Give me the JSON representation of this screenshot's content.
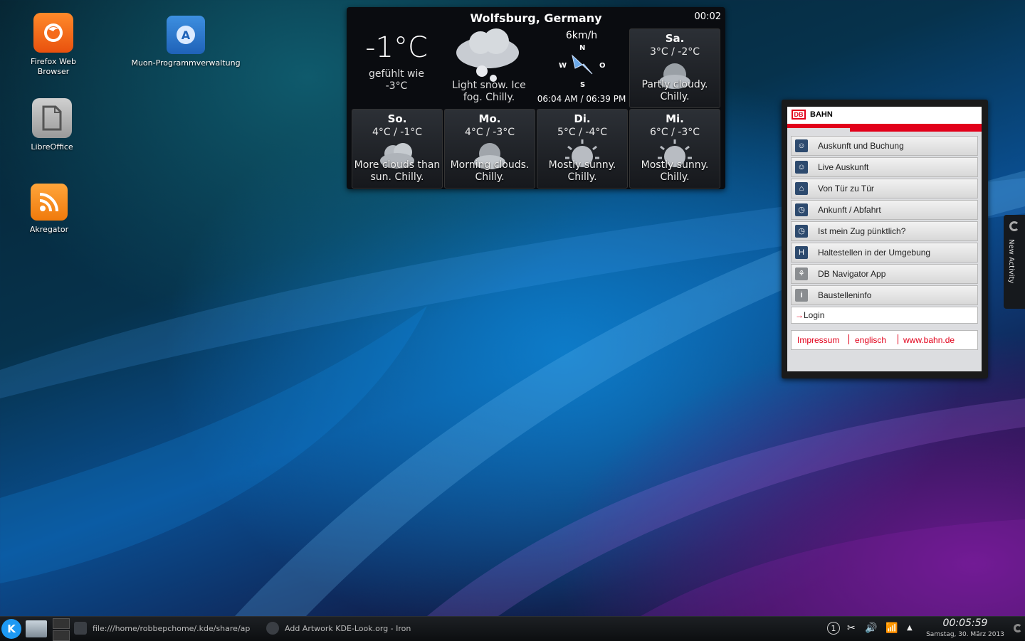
{
  "desktop": {
    "icons": [
      {
        "label_line1": "Firefox Web",
        "label_line2": "Browser"
      },
      {
        "label_line1": "Muon-Programmverwaltung"
      },
      {
        "label_line1": "LibreOffice"
      },
      {
        "label_line1": "Akregator"
      }
    ]
  },
  "weather": {
    "location": "Wolfsburg, Germany",
    "time": "00:02",
    "temperature": "-1°C",
    "feels_like_line1": "gefühlt wie",
    "feels_like_line2": "-3°C",
    "condition_line1": "Light snow. Ice",
    "condition_line2": "fog. Chilly.",
    "wind_speed": "6km/h",
    "compass": {
      "n": "N",
      "w": "W",
      "o": "O",
      "s": "S"
    },
    "sun_times": "06:04 AM / 06:39 PM",
    "days": [
      {
        "name": "Sa.",
        "temps": "3°C / -2°C",
        "cond_line1": "Partly cloudy.",
        "cond_line2": "Chilly."
      },
      {
        "name": "So.",
        "temps": "4°C / -1°C",
        "cond_line1": "More clouds than",
        "cond_line2": "sun. Chilly."
      },
      {
        "name": "Mo.",
        "temps": "4°C / -3°C",
        "cond_line1": "Morning clouds.",
        "cond_line2": "Chilly."
      },
      {
        "name": "Di.",
        "temps": "5°C / -4°C",
        "cond_line1": "Mostly sunny.",
        "cond_line2": "Chilly."
      },
      {
        "name": "Mi.",
        "temps": "6°C / -3°C",
        "cond_line1": "Mostly sunny.",
        "cond_line2": "Chilly."
      }
    ]
  },
  "db": {
    "logo": "DB",
    "brand": "BAHN",
    "menu": [
      {
        "label": "Auskunft und Buchung",
        "icon": "☺"
      },
      {
        "label": "Live Auskunft",
        "icon": "☺"
      },
      {
        "label": "Von Tür zu Tür",
        "icon": "⌂"
      },
      {
        "label": "Ankunft / Abfahrt",
        "icon": "◷"
      },
      {
        "label": "Ist mein Zug pünktlich?",
        "icon": "◷"
      },
      {
        "label": "Haltestellen in der Umgebung",
        "icon": "H"
      },
      {
        "label": "DB Navigator App",
        "icon": "⚘"
      },
      {
        "label": "Baustelleninfo",
        "icon": "i"
      }
    ],
    "login": {
      "arrow": "→",
      "label": "Login"
    },
    "footer": {
      "impressum": "Impressum",
      "englisch": "englisch",
      "site": "www.bahn.de"
    },
    "accent": "#e2001a"
  },
  "activity": {
    "label": "New Activity"
  },
  "taskbar": {
    "start": "K",
    "tasks": [
      {
        "label": "file:///home/robbepchome/.kde/share/ap"
      },
      {
        "label": "Add  Artwork KDE-Look.org - Iron"
      }
    ],
    "tray": {
      "notifications": "1",
      "clipboard": "✂",
      "volume": "🔊",
      "network": "📶",
      "expand": "▲"
    },
    "clock": {
      "time": "00:05:59",
      "date": "Samstag, 30. März 2013"
    }
  }
}
